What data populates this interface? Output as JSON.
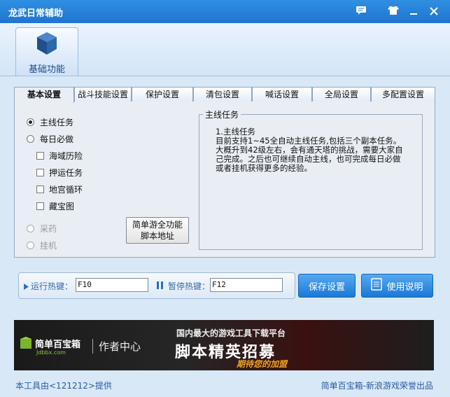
{
  "window": {
    "title": "龙武日常辅助"
  },
  "ribbon": {
    "item_label": "基础功能"
  },
  "tabs": [
    {
      "label": "基本设置"
    },
    {
      "label": "战斗技能设置"
    },
    {
      "label": "保护设置"
    },
    {
      "label": "清包设置"
    },
    {
      "label": "喊话设置"
    },
    {
      "label": "全局设置"
    },
    {
      "label": "多配置设置"
    }
  ],
  "basic": {
    "radio_main": "主线任务",
    "radio_daily": "每日必做",
    "checks": [
      "海域历险",
      "押运任务",
      "地宫循环",
      "藏宝图"
    ],
    "radio_herb": "采药",
    "radio_idle": "挂机",
    "link_button_line1": "简单游全功能",
    "link_button_line2": "脚本地址"
  },
  "group": {
    "title": "主线任务",
    "text": "1.主线任务\n目前支持1~45全自动主线任务,包括三个副本任务。大概升到42级左右，会有通天塔的挑战，需要大家自己完成。之后也可继续自动主线，也可完成每日必做或者挂机获得更多的经验。"
  },
  "hotkeys": {
    "run_label": "运行热键：",
    "run_value": "F10",
    "pause_label": "暂停热键：",
    "pause_value": "F12"
  },
  "buttons": {
    "save": "保存设置",
    "help": "使用说明"
  },
  "banner": {
    "brand": "简单百宝箱",
    "domain": "Jdbbx.com",
    "author": "作者中心",
    "headline_small": "国内最大的游戏工具下载平台",
    "headline_big": "脚本精英招募",
    "tagline": "期待您的加盟"
  },
  "footer": {
    "left": "本工具由<121212>提供",
    "right": "简单百宝箱-新浪游戏荣誉出品"
  }
}
